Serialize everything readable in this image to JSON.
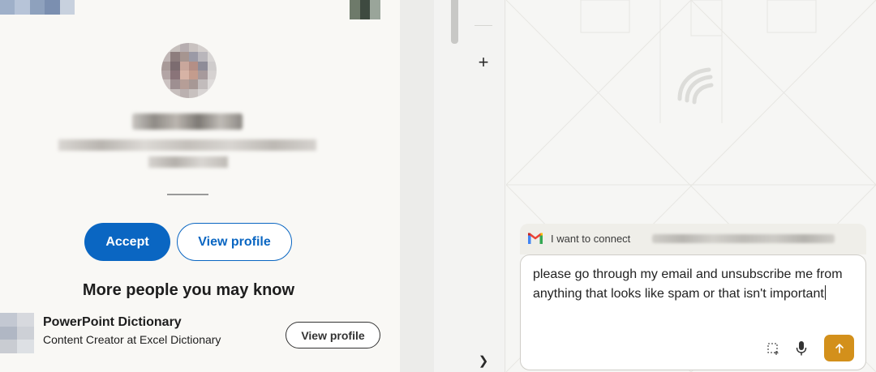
{
  "linkedin": {
    "accept_label": "Accept",
    "view_profile_label": "View profile",
    "section_title": "More people you may know",
    "people": [
      {
        "name": "PowerPoint Dictionary",
        "headline": "Content Creator at Excel Dictionary",
        "button_label": "View profile"
      }
    ]
  },
  "assistant": {
    "sidebar": {
      "new_icon": "plus-icon",
      "expand_icon": "chevron-right-icon"
    },
    "connect_bar": {
      "icon": "gmail-icon",
      "text": "I want to connect"
    },
    "prompt": {
      "value": "please go through my email and unsubscribe me from anything that looks like spam or that isn't important"
    },
    "toolbar": {
      "select_icon": "select-region-icon",
      "mic_icon": "microphone-icon",
      "send_icon": "arrow-up-icon"
    },
    "colors": {
      "linkedin_blue": "#0a66c2",
      "send_accent": "#d3901b"
    }
  }
}
